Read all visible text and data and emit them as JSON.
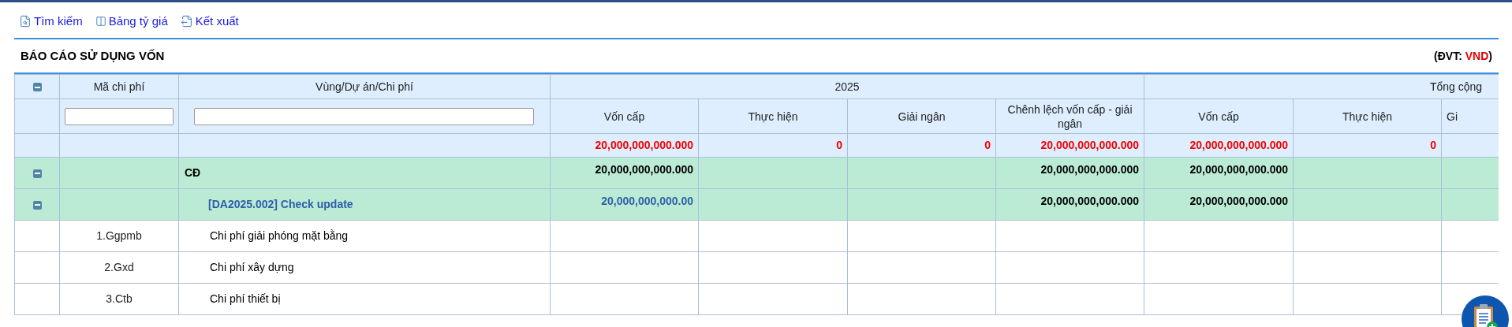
{
  "toolbar": [
    {
      "label": "Tìm kiếm",
      "kind": "search"
    },
    {
      "label": "Bảng tỷ giá",
      "kind": "rates"
    },
    {
      "label": "Kết xuất",
      "kind": "export"
    }
  ],
  "report": {
    "title": "BÁO CÁO SỬ DỤNG VỐN",
    "unit_label": "(ĐVT:",
    "unit": "VND",
    "unit_close": ")"
  },
  "table": {
    "expanded": true,
    "columns": [
      "Mã chi phí",
      "Vùng/Dự án/Chi phí"
    ],
    "groups": [
      {
        "label": "2025",
        "columns": [
          "Vốn cấp",
          "Thực hiện",
          "Giải ngân",
          "Chênh lệch vốn cấp - giải ngân"
        ]
      },
      {
        "label": "Tổng cộng",
        "columns": [
          "Vốn cấp",
          "Thực hiện",
          "Gi"
        ]
      }
    ],
    "totals": {
      "year": {
        "von_cap": "20,000,000,000.000",
        "thuc_hien": "0",
        "giai_ngan": "0",
        "chenh_lech": "20,000,000,000.000"
      },
      "total": {
        "von_cap": "20,000,000,000.000",
        "thuc_hien": "0"
      }
    },
    "rows": [
      {
        "kind": "group",
        "expanded": true,
        "name": "CĐ",
        "values": {
          "year": {
            "von_cap": {
              "text": "20,000,000,000.000",
              "link": false
            },
            "chenh_lech": {
              "text": "20,000,000,000.000",
              "link": false
            }
          },
          "total": {
            "von_cap": {
              "text": "20,000,000,000.000",
              "link": false
            }
          }
        },
        "children": [
          {
            "kind": "project",
            "expanded": true,
            "name": "[DA2025.002] Check update",
            "values": {
              "year": {
                "von_cap": {
                  "text": "20,000,000,000.00",
                  "link": true
                },
                "chenh_lech": {
                  "text": "20,000,000,000.000",
                  "link": false
                }
              },
              "total": {
                "von_cap": {
                  "text": "20,000,000,000.000",
                  "link": false
                }
              }
            },
            "children": [
              {
                "kind": "item",
                "code": "1.Ggpmb",
                "name": "Chi phí giải phóng mặt bằng"
              },
              {
                "kind": "item",
                "code": "2.Gxd",
                "name": "Chi phí xây dựng"
              },
              {
                "kind": "item",
                "code": "3.Ctb",
                "name": "Chi phí thiết bị"
              }
            ]
          }
        ]
      }
    ]
  }
}
